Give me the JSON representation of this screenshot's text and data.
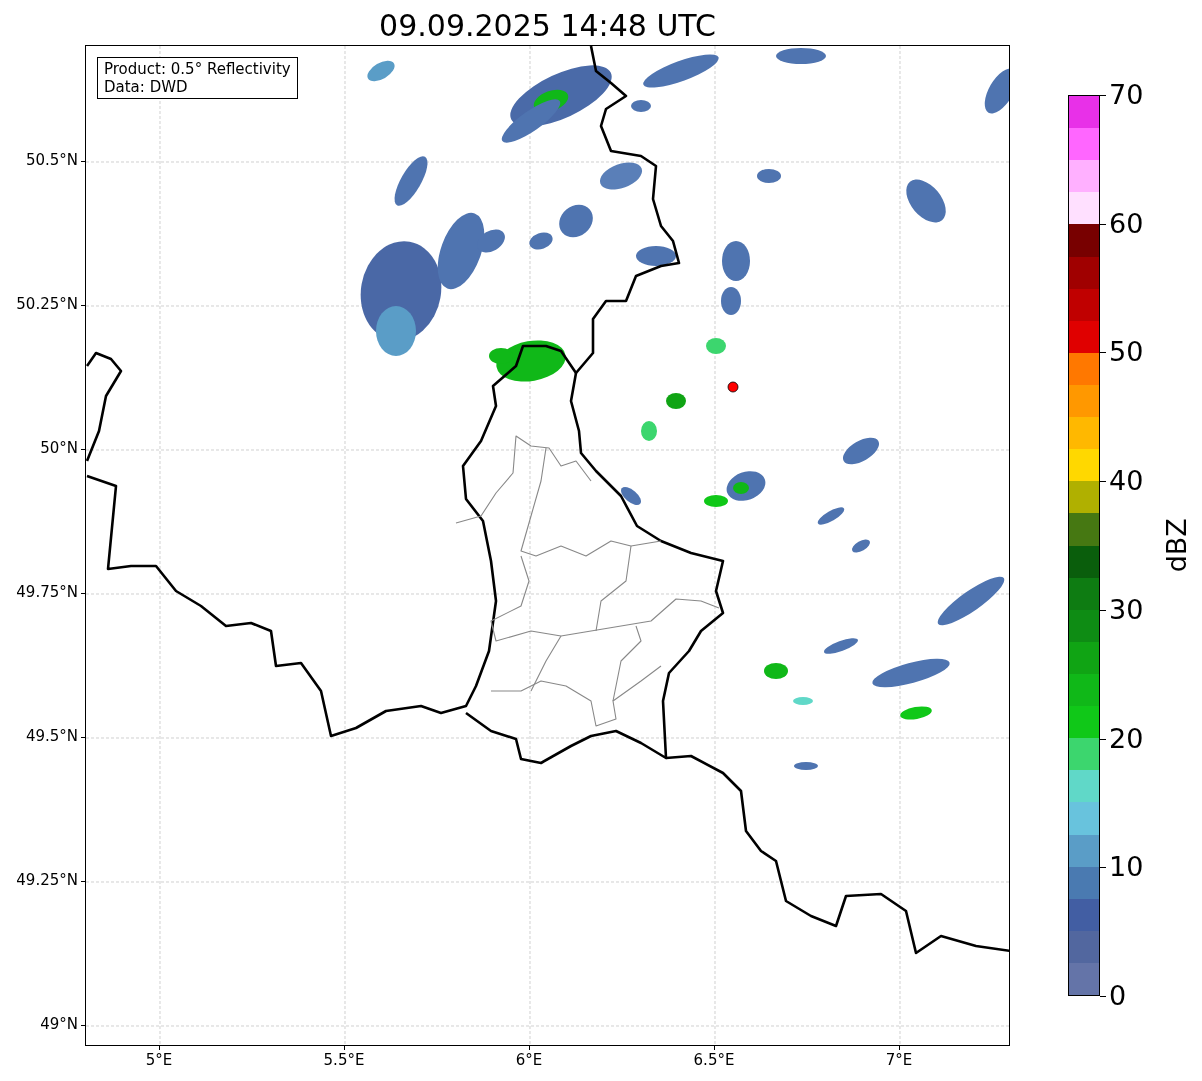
{
  "title": "09.09.2025 14:48 UTC",
  "info_box": {
    "lines": [
      "Product: 0.5° Reflectivity",
      "Data: DWD"
    ]
  },
  "map": {
    "latitude_labels": [
      "50.5°N",
      "50.25°N",
      "50°N",
      "49.75°N",
      "49.5°N",
      "49.25°N",
      "49°N"
    ],
    "longitude_labels": [
      "5°E",
      "5.5°E",
      "6°E",
      "6.5°E",
      "7°E"
    ]
  },
  "colorbar": {
    "label": "dBZ",
    "ticks": [
      "70",
      "60",
      "50",
      "40",
      "30",
      "20",
      "10",
      "0"
    ],
    "segments": [
      {
        "color": "#e830e8"
      },
      {
        "color": "#ff66ff"
      },
      {
        "color": "#ffb0ff"
      },
      {
        "color": "#ffe0ff"
      },
      {
        "color": "#780000"
      },
      {
        "color": "#a00000"
      },
      {
        "color": "#c00000"
      },
      {
        "color": "#e00000"
      },
      {
        "color": "#ff7800"
      },
      {
        "color": "#ff9800"
      },
      {
        "color": "#ffb800"
      },
      {
        "color": "#ffd800"
      },
      {
        "color": "#b0b000"
      },
      {
        "color": "#467812"
      },
      {
        "color": "#0a5e0c"
      },
      {
        "color": "#0e7c12"
      },
      {
        "color": "#0e8c14"
      },
      {
        "color": "#10a414"
      },
      {
        "color": "#10b818"
      },
      {
        "color": "#10c818"
      },
      {
        "color": "#3cd66e"
      },
      {
        "color": "#60d8c8"
      },
      {
        "color": "#68c3dd"
      },
      {
        "color": "#5a9dc7"
      },
      {
        "color": "#4a7ab1"
      },
      {
        "color": "#425ea3"
      },
      {
        "color": "#52679f"
      },
      {
        "color": "#6474a8"
      }
    ]
  }
}
